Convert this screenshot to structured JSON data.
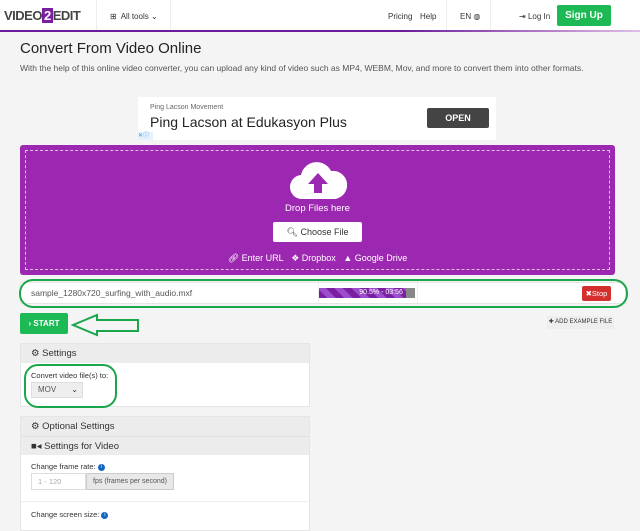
{
  "header": {
    "logo": "VIDEO 2 EDIT",
    "all_tools": "All tools",
    "pricing": "Pricing",
    "help": "Help",
    "lang": "EN",
    "login": "Log In",
    "signup": "Sign Up"
  },
  "page": {
    "title": "Convert From Video Online",
    "description": "With the help of this online video converter, you can upload any kind of video such as MP4, WEBM, Mov, and more to convert them into other formats."
  },
  "ad": {
    "advertiser": "Ping Lacson Movement",
    "headline": "Ping Lacson at Edukasyon Plus",
    "cta": "OPEN"
  },
  "upload": {
    "drop_text": "Drop Files here",
    "choose_file": "Choose File",
    "enter_url": "Enter URL",
    "dropbox": "Dropbox",
    "google_drive": "Google Drive"
  },
  "file": {
    "name": "sample_1280x720_surfing_with_audio.mxf",
    "progress_label": "90.5% - 03:56",
    "progress_percent": 90.5,
    "stop": "Stop"
  },
  "actions": {
    "start": "START",
    "add_example": "ADD EXAMPLE FILE"
  },
  "settings": {
    "title": "Settings",
    "convert_label": "Convert video file(s) to:",
    "format": "MOV"
  },
  "optional": {
    "title": "Optional Settings",
    "video_title": "Settings for Video",
    "frame_rate_label": "Change frame rate:",
    "frame_rate_placeholder": "1 - 120",
    "frame_rate_unit": "fps (frames per second)",
    "screen_size_label": "Change screen size:"
  },
  "colors": {
    "brand_purple": "#9c27b0",
    "accent_green": "#1db954",
    "stop_red": "#d32f2f",
    "annotation_green": "#1aa64a"
  }
}
